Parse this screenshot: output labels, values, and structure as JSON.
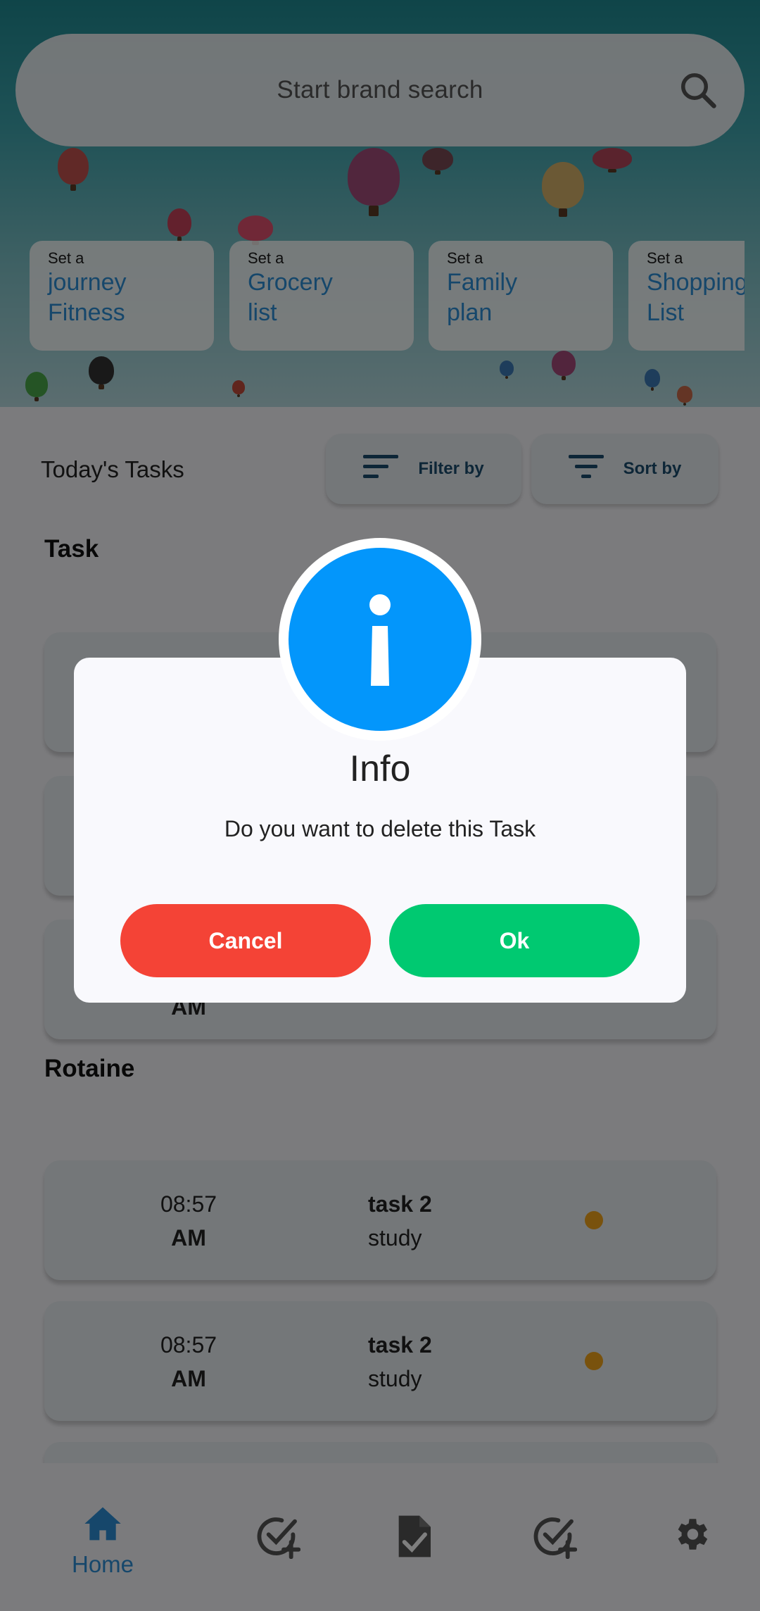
{
  "search": {
    "placeholder": "Start brand search"
  },
  "quick_actions": [
    {
      "pre": "Set a",
      "title": "journey\nFitness"
    },
    {
      "pre": "Set a",
      "title": "Grocery\nlist"
    },
    {
      "pre": "Set a",
      "title": "Family\nplan"
    },
    {
      "pre": "Set a",
      "title": "Shopping\nList"
    }
  ],
  "tasks_header": {
    "title": "Today's Tasks",
    "filter_label": "Filter by",
    "sort_label": "Sort by"
  },
  "sections": {
    "task": "Task",
    "routine": "Rotaine"
  },
  "routine_items": [
    {
      "time": "08:57",
      "ampm": "AM",
      "name": "task 2",
      "category": "study",
      "status_color": "#f2a51a"
    },
    {
      "time": "08:57",
      "ampm": "AM",
      "name": "task 2",
      "category": "study",
      "status_color": "#f2a51a"
    }
  ],
  "partial_card": {
    "ampm": "AM"
  },
  "nav": {
    "items": [
      {
        "icon": "home-icon",
        "label": "Home",
        "active": true
      },
      {
        "icon": "task-add-icon"
      },
      {
        "icon": "document-check-icon"
      },
      {
        "icon": "task-add-icon"
      },
      {
        "icon": "gear-icon"
      }
    ],
    "home_label": "Home"
  },
  "dialog": {
    "icon": "info-icon",
    "title": "Info",
    "message": "Do you want to delete this Task",
    "cancel_label": "Cancel",
    "ok_label": "Ok"
  },
  "colors": {
    "accent": "#2d8fd6",
    "info": "#0396fb",
    "cancel": "#f44336",
    "ok": "#00c971",
    "status_dot": "#f2a51a"
  }
}
